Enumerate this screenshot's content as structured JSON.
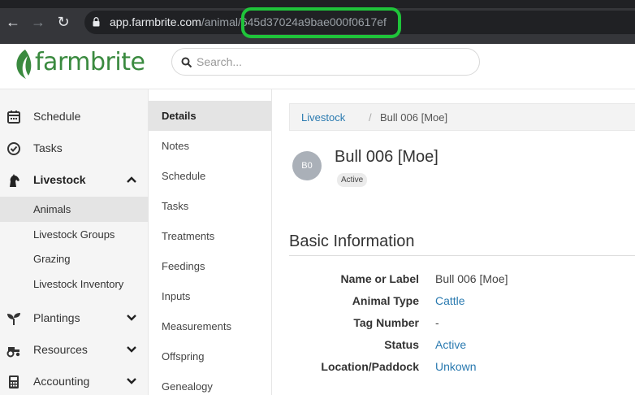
{
  "browser": {
    "url_host": "app.farmbrite.com",
    "url_path_dim": "/animal",
    "url_path_id": "/645d37024a9bae000f0617ef"
  },
  "header": {
    "logo_text": "farmbrite",
    "search_placeholder": "Search..."
  },
  "sidebar": {
    "items": [
      {
        "label": "Schedule",
        "icon": "calendar-icon"
      },
      {
        "label": "Tasks",
        "icon": "check-circle-icon"
      },
      {
        "label": "Livestock",
        "icon": "horse-icon"
      },
      {
        "label": "Plantings",
        "icon": "sprout-icon"
      },
      {
        "label": "Resources",
        "icon": "tractor-icon"
      },
      {
        "label": "Accounting",
        "icon": "calculator-icon"
      }
    ],
    "livestock_sub": [
      {
        "label": "Animals"
      },
      {
        "label": "Livestock Groups"
      },
      {
        "label": "Grazing"
      },
      {
        "label": "Livestock Inventory"
      }
    ]
  },
  "subnav": {
    "items": [
      {
        "label": "Details"
      },
      {
        "label": "Notes"
      },
      {
        "label": "Schedule"
      },
      {
        "label": "Tasks"
      },
      {
        "label": "Treatments"
      },
      {
        "label": "Feedings"
      },
      {
        "label": "Inputs"
      },
      {
        "label": "Measurements"
      },
      {
        "label": "Offspring"
      },
      {
        "label": "Genealogy"
      }
    ]
  },
  "breadcrumb": {
    "parent": "Livestock",
    "separator": "/",
    "current": "Bull 006 [Moe]"
  },
  "animal": {
    "avatar_initials": "B0",
    "title": "Bull 006 [Moe]",
    "status_badge": "Active"
  },
  "basic_info": {
    "section_title": "Basic Information",
    "fields": [
      {
        "label": "Name or Label",
        "value": "Bull 006 [Moe]"
      },
      {
        "label": "Animal Type",
        "value": "Cattle"
      },
      {
        "label": "Tag Number",
        "value": "-"
      },
      {
        "label": "Status",
        "value": "Active"
      },
      {
        "label": "Location/Paddock",
        "value": "Unkown"
      }
    ]
  },
  "colors": {
    "brand_green": "#3a8a3f",
    "link_blue": "#2a7ab0",
    "highlight_green": "#1fc43a"
  }
}
